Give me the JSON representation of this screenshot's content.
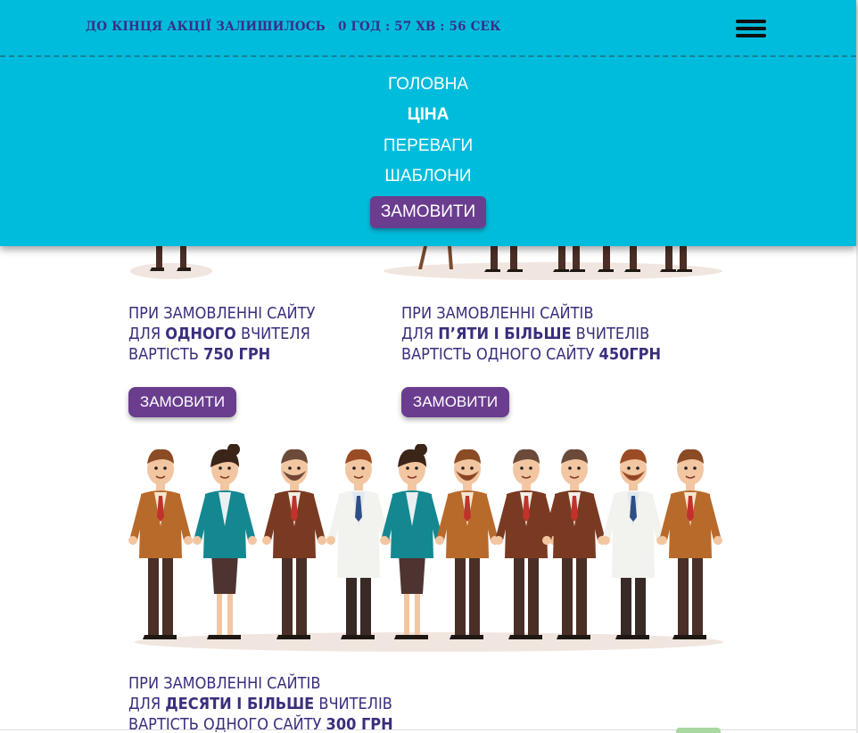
{
  "promo": {
    "label": "ДО КІНЦЯ АКЦІЇ ЗАЛИШИЛОСЬ",
    "countdown": "0 ГОД : 57 ХВ : 56 СЕК"
  },
  "menu": {
    "items": [
      {
        "label": "ГОЛОВНА"
      },
      {
        "label": "ЦІНА"
      },
      {
        "label": "ПЕРЕВАГИ"
      },
      {
        "label": "ШАБЛОНИ"
      }
    ],
    "order_label": "ЗАМОВИТИ"
  },
  "offers": [
    {
      "line1": "ПРИ ЗАМОВЛЕННІ САЙТУ",
      "line2_pre": "ДЛЯ ",
      "line2_bold": "ОДНОГО",
      "line2_post": " ВЧИТЕЛЯ",
      "line3_pre": "ВАРТІСТЬ ",
      "line3_bold": "750 ГРН",
      "button": "ЗАМОВИТИ"
    },
    {
      "line1": "ПРИ ЗАМОВЛЕННІ САЙТІВ",
      "line2_pre": "ДЛЯ ",
      "line2_bold": "П’ЯТИ І БІЛЬШЕ",
      "line2_post": " ВЧИТЕЛІВ",
      "line3_pre": "ВАРТІСТЬ ОДНОГО САЙТУ ",
      "line3_bold": "450ГРН",
      "button": "ЗАМОВИТИ"
    },
    {
      "line1": "ПРИ ЗАМОВЛЕННІ САЙТІВ",
      "line2_pre": "ДЛЯ ",
      "line2_bold": "ДЕСЯТИ І БІЛЬШЕ",
      "line2_post": " ВЧИТЕЛІВ",
      "line3_pre": "ВАРТІСТЬ ОДНОГО САЙТУ ",
      "line3_bold": "300 ГРН"
    }
  ],
  "colors": {
    "header_bg": "#00bcdc",
    "accent_button": "#6a3d8f",
    "text_primary": "#3a2e7c"
  },
  "icons": {
    "menu": "hamburger-menu-icon"
  }
}
